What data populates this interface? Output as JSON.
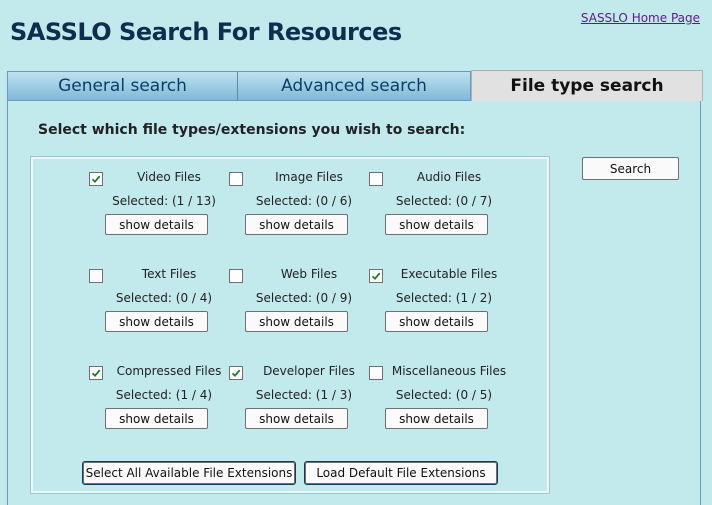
{
  "header": {
    "title": "SASSLO Search For Resources",
    "home_link": "SASSLO Home Page"
  },
  "tabs": [
    {
      "label": "General search",
      "active": false
    },
    {
      "label": "Advanced search",
      "active": false
    },
    {
      "label": "File type search",
      "active": true
    }
  ],
  "main": {
    "instructions": "Select which file types/extensions you wish to search:",
    "search_button": "Search",
    "show_details_label": "show details",
    "file_types": [
      {
        "label": "Video Files",
        "checked": true,
        "selected": "Selected: (1 / 13)"
      },
      {
        "label": "Image Files",
        "checked": false,
        "selected": "Selected: (0 / 6)"
      },
      {
        "label": "Audio Files",
        "checked": false,
        "selected": "Selected: (0 / 7)"
      },
      {
        "label": "Text Files",
        "checked": false,
        "selected": "Selected: (0 / 4)"
      },
      {
        "label": "Web Files",
        "checked": false,
        "selected": "Selected: (0 / 9)"
      },
      {
        "label": "Executable Files",
        "checked": true,
        "selected": "Selected: (1 / 2)"
      },
      {
        "label": "Compressed Files",
        "checked": true,
        "selected": "Selected: (1 / 4)"
      },
      {
        "label": "Developer Files",
        "checked": true,
        "selected": "Selected: (1 / 3)"
      },
      {
        "label": "Miscellaneous Files",
        "checked": false,
        "selected": "Selected: (0 / 5)"
      }
    ],
    "select_all_button": "Select All Available File Extensions",
    "load_default_button": "Load Default File Extensions"
  },
  "colors": {
    "background": "#c2e9eb",
    "title": "#0f2d4e",
    "link": "#5a1a8a",
    "checkmark": "#1f7a2a"
  }
}
